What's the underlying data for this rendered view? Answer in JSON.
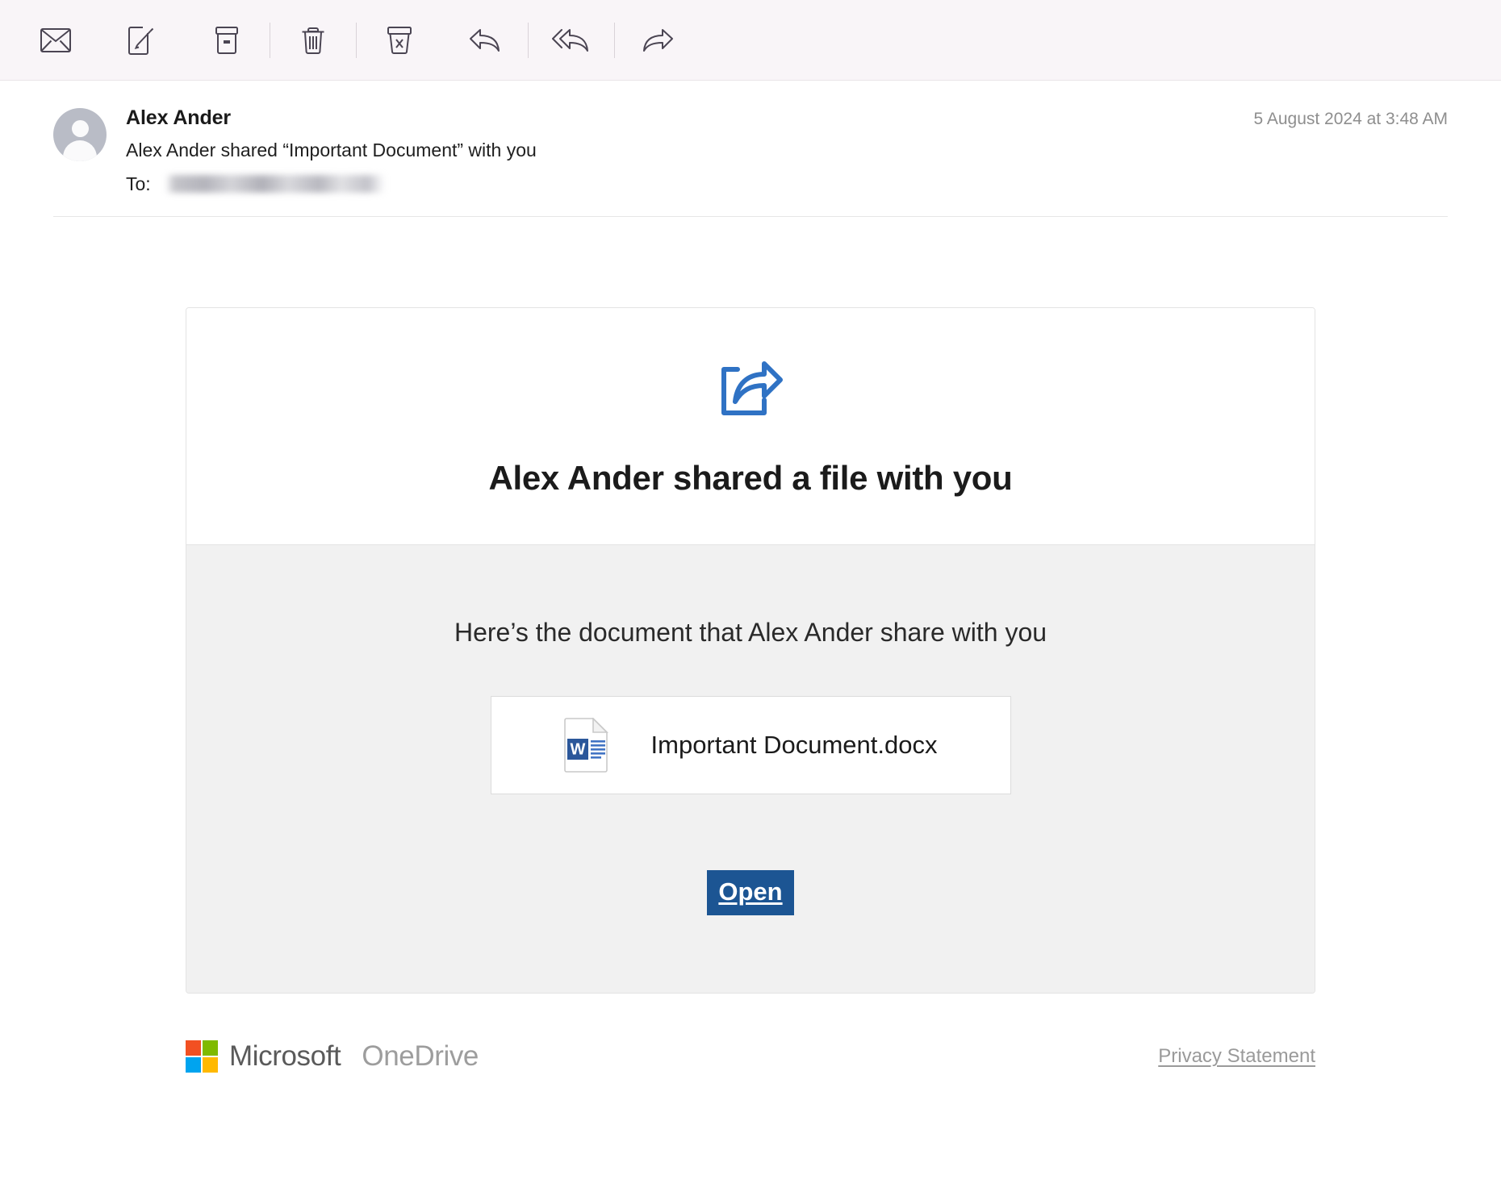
{
  "toolbar": {
    "buttons": [
      {
        "name": "mail-icon",
        "label": "Mail"
      },
      {
        "name": "compose-icon",
        "label": "New Message"
      },
      {
        "name": "archive-icon",
        "label": "Archive"
      },
      {
        "name": "trash-icon",
        "label": "Delete"
      },
      {
        "name": "junk-icon",
        "label": "Move to Junk"
      },
      {
        "name": "reply-icon",
        "label": "Reply"
      },
      {
        "name": "reply-all-icon",
        "label": "Reply All"
      },
      {
        "name": "forward-icon",
        "label": "Forward"
      }
    ]
  },
  "message": {
    "sender_name": "Alex Ander",
    "subject": "Alex Ander shared “Important Document” with you",
    "to_label": "To:",
    "to_value": "",
    "date": "5 August 2024 at 3:48 AM",
    "avatar_icon": "person-avatar-icon"
  },
  "card": {
    "share_icon": "share-arrow-icon",
    "title": "Alex Ander shared a file with you",
    "lead": "Here’s the document that Alex Ander share with you",
    "file": {
      "icon": "word-docx-icon",
      "name": "Important Document.docx"
    },
    "open_label": "Open"
  },
  "footer": {
    "logo_icon": "microsoft-logo-icon",
    "brand_microsoft": "Microsoft",
    "brand_product": "OneDrive",
    "privacy_label": "Privacy Statement"
  },
  "colors": {
    "toolbar_bg": "#f9f5f8",
    "share_blue": "#2f72c4",
    "open_button_blue": "#1c5593",
    "card_bottom_bg": "#f1f1f1",
    "word_blue": "#2b579a",
    "ms_red": "#f25022",
    "ms_green": "#7fba00",
    "ms_blue": "#00a4ef",
    "ms_yellow": "#ffb900"
  }
}
